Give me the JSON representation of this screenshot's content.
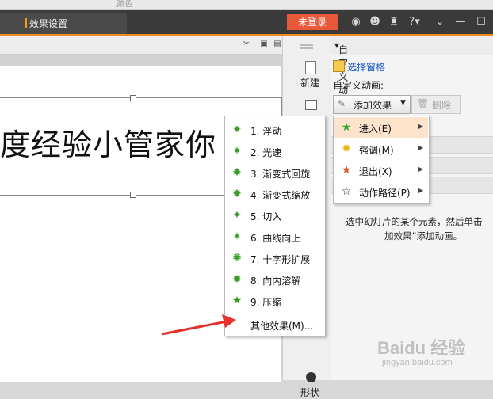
{
  "top_strip": {
    "text": "颜色"
  },
  "titlebar": {
    "tab_label": "效果设置",
    "login_label": "未登录",
    "help_label": "?",
    "icons": [
      "skin-icon",
      "tshirt-icon",
      "help-icon",
      "chevron-down-icon",
      "minimize-icon",
      "maximize-icon"
    ]
  },
  "toolbar": {
    "new_label": "新建",
    "shape_label": "形状"
  },
  "slide": {
    "text": "度经验小管家你"
  },
  "panel": {
    "title": "自定义动画",
    "select_pane": "选择窗格",
    "custom_label": "自定义动画:",
    "add_effect": "添加效果",
    "delete": "删除",
    "hint_line1": "选中幻灯片的某个元素，然后单击",
    "hint_line2": "加效果”添加动画。"
  },
  "effects_menu": {
    "items": [
      {
        "label": "1. 浮动"
      },
      {
        "label": "2. 光速"
      },
      {
        "label": "3. 渐变式回旋"
      },
      {
        "label": "4. 渐变式缩放"
      },
      {
        "label": "5. 切入"
      },
      {
        "label": "6. 曲线向上"
      },
      {
        "label": "7. 十字形扩展"
      },
      {
        "label": "8. 向内溶解"
      },
      {
        "label": "9. 压缩"
      }
    ],
    "more": "其他效果(M)..."
  },
  "submenu": {
    "items": [
      {
        "label": "进入(E)",
        "icon": "green-star-icon",
        "color": "#2fa52a"
      },
      {
        "label": "强调(M)",
        "icon": "yellow-burst-icon",
        "color": "#e7b712"
      },
      {
        "label": "退出(X)",
        "icon": "red-star-icon",
        "color": "#d9541e"
      },
      {
        "label": "动作路径(P)",
        "icon": "outline-star-icon",
        "color": "#333333"
      }
    ]
  },
  "watermark": {
    "brand": "Baidu 经验",
    "url": "jingyan.baidu.com"
  },
  "colors": {
    "accent": "#f08a24",
    "login": "#e8593a",
    "link": "#1a56c7",
    "highlight": "#fde2cc"
  }
}
